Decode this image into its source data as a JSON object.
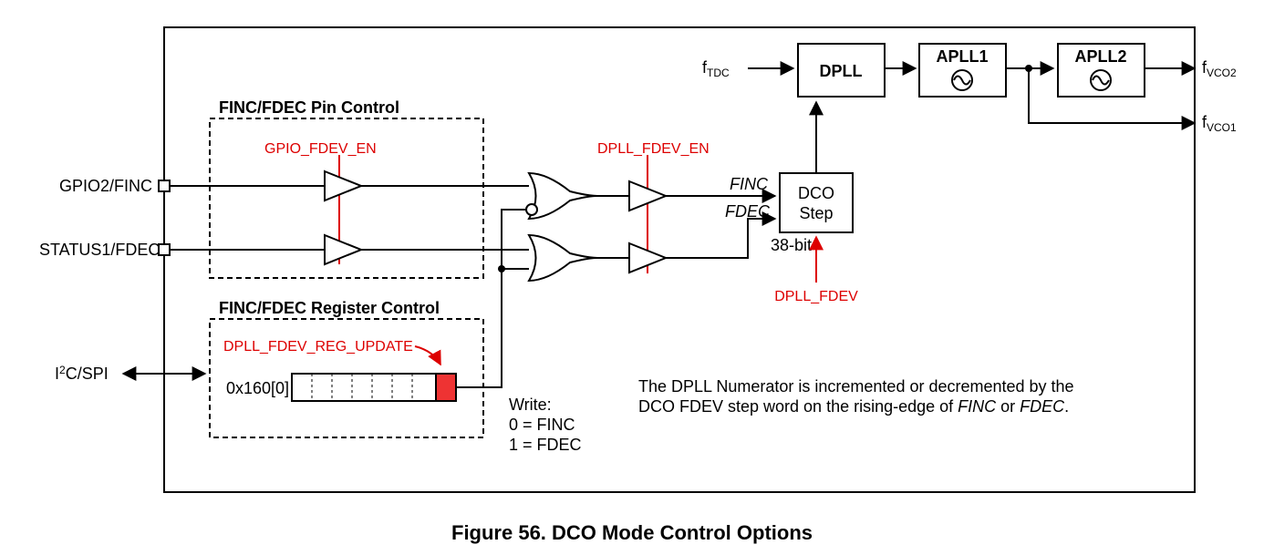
{
  "caption": "Figure 56.  DCO Mode Control Options",
  "pinControl": {
    "title": "FINC/FDEC Pin Control",
    "enable": "GPIO_FDEV_EN"
  },
  "regControl": {
    "title": "FINC/FDEC Register Control",
    "reg": "DPLL_FDEV_REG_UPDATE",
    "addr": "0x160[0]",
    "write": "Write:",
    "w0": "0 = FINC",
    "w1": "1 = FDEC"
  },
  "dpllEn": "DPLL_FDEV_EN",
  "io": {
    "gpio2": "GPIO2/FINC",
    "status1": "STATUS1/FDEC",
    "i2c": "I²C/SPI",
    "ftdc_pre": "f",
    "ftdc_sub": "TDC",
    "fvco1_pre": "f",
    "fvco1_sub": "VCO1",
    "fvco2_pre": "f",
    "fvco2_sub": "VCO2"
  },
  "sig": {
    "finc": "FINC",
    "fdec": "FDEC"
  },
  "blocks": {
    "dpll": "DPLL",
    "apll1": "APLL1",
    "apll2": "APLL2",
    "dco1": "DCO",
    "dco2": "Step",
    "bits": "38-bit",
    "fdev": "DPLL_FDEV"
  },
  "note1": "The DPLL Numerator is incremented or decremented by the",
  "note2": "DCO FDEV step word on the rising-edge of ",
  "note3": "FINC",
  "note4": " or ",
  "note5": "FDEC",
  "note6": "."
}
